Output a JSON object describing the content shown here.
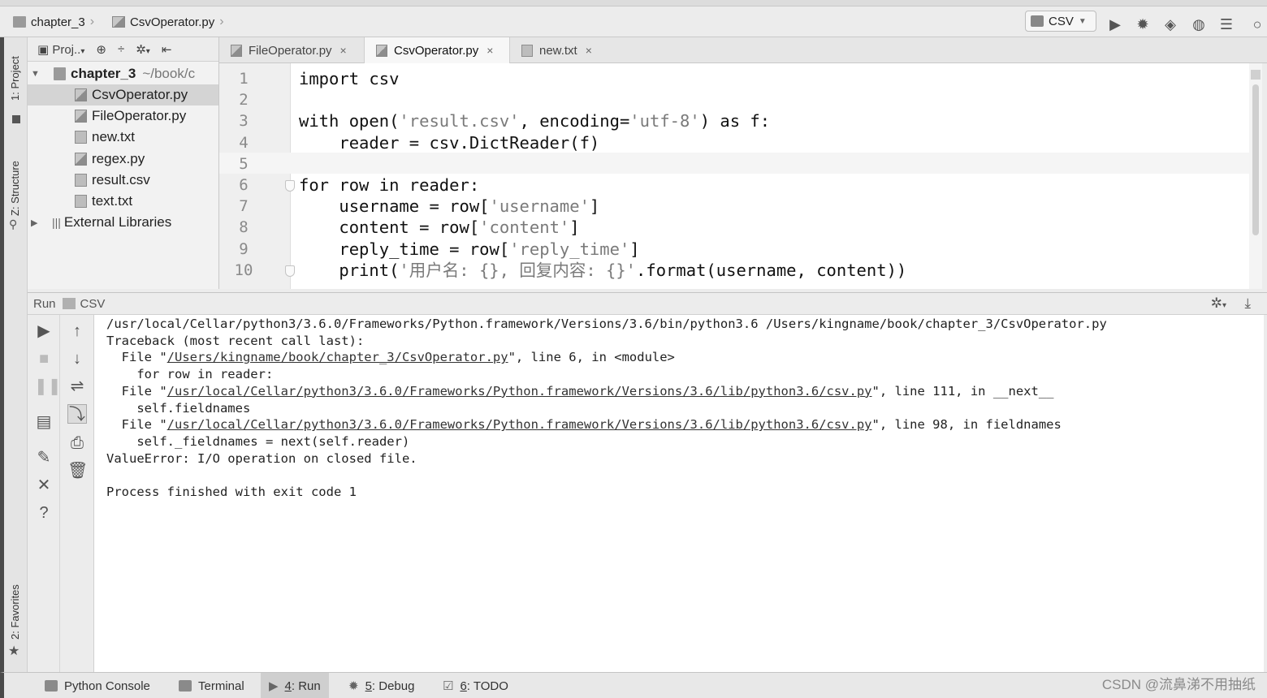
{
  "navbar": {
    "crumbs": [
      "chapter_3",
      "CsvOperator.py"
    ],
    "run_config": "CSV",
    "icons": [
      "run-icon",
      "debug-icon",
      "coverage-icon",
      "profile-icon",
      "build-icon",
      "search-icon"
    ]
  },
  "left_strip": {
    "project": "1: Project",
    "structure": "Z: Structure",
    "favorites": "2: Favorites"
  },
  "project_panel": {
    "toolbar_label": "Proj..",
    "root": {
      "name": "chapter_3",
      "path": "~/book/c"
    },
    "files": [
      "CsvOperator.py",
      "FileOperator.py",
      "new.txt",
      "regex.py",
      "result.csv",
      "text.txt"
    ],
    "selected": "CsvOperator.py",
    "libraries": "External Libraries"
  },
  "tabs": [
    {
      "label": "FileOperator.py",
      "close": "×"
    },
    {
      "label": "CsvOperator.py",
      "close": "×",
      "active": true
    },
    {
      "label": "new.txt",
      "close": "×"
    }
  ],
  "editor": {
    "line_numbers": [
      "1",
      "2",
      "3",
      "4",
      "5",
      "6",
      "7",
      "8",
      "9",
      "10"
    ],
    "lines": [
      [
        {
          "t": "import csv"
        }
      ],
      [
        {
          "t": ""
        }
      ],
      [
        {
          "t": "with open("
        },
        {
          "t": "'result.csv'",
          "s": true
        },
        {
          "t": ", encoding="
        },
        {
          "t": "'utf-8'",
          "s": true
        },
        {
          "t": ") as f:"
        }
      ],
      [
        {
          "t": "    reader = csv.DictReader(f)"
        }
      ],
      [
        {
          "t": ""
        }
      ],
      [
        {
          "t": "for row in reader:"
        }
      ],
      [
        {
          "t": "    username = row["
        },
        {
          "t": "'username'",
          "s": true
        },
        {
          "t": "]"
        }
      ],
      [
        {
          "t": "    content = row["
        },
        {
          "t": "'content'",
          "s": true
        },
        {
          "t": "]"
        }
      ],
      [
        {
          "t": "    reply_time = row["
        },
        {
          "t": "'reply_time'",
          "s": true
        },
        {
          "t": "]"
        }
      ],
      [
        {
          "t": "    print("
        },
        {
          "t": "'用户名: {}, 回复内容: {}'",
          "s": true
        },
        {
          "t": ".format(username, content))"
        }
      ]
    ]
  },
  "run_panel": {
    "label": "Run",
    "config": "CSV",
    "console": [
      [
        {
          "t": "/usr/local/Cellar/python3/3.6.0/Frameworks/Python.framework/Versions/3.6/bin/python3.6 /Users/kingname/book/chapter_3/CsvOperator.py"
        }
      ],
      [
        {
          "t": "Traceback (most recent call last):"
        }
      ],
      [
        {
          "t": "  File \""
        },
        {
          "t": "/Users/kingname/book/chapter_3/CsvOperator.py",
          "l": true
        },
        {
          "t": "\", line 6, in <module>"
        }
      ],
      [
        {
          "t": "    for row in reader:"
        }
      ],
      [
        {
          "t": "  File \""
        },
        {
          "t": "/usr/local/Cellar/python3/3.6.0/Frameworks/Python.framework/Versions/3.6/lib/python3.6/csv.py",
          "l": true
        },
        {
          "t": "\", line 111, in __next__"
        }
      ],
      [
        {
          "t": "    self.fieldnames"
        }
      ],
      [
        {
          "t": "  File \""
        },
        {
          "t": "/usr/local/Cellar/python3/3.6.0/Frameworks/Python.framework/Versions/3.6/lib/python3.6/csv.py",
          "l": true
        },
        {
          "t": "\", line 98, in fieldnames"
        }
      ],
      [
        {
          "t": "    self._fieldnames = next(self.reader)"
        }
      ],
      [
        {
          "t": "ValueError: I/O operation on closed file."
        }
      ],
      [
        {
          "t": ""
        }
      ],
      [
        {
          "t": "Process finished with exit code 1"
        }
      ]
    ]
  },
  "bottom_tabs": [
    {
      "pre": "",
      "key": "",
      "post": "Python Console"
    },
    {
      "pre": "",
      "key": "",
      "post": "Terminal"
    },
    {
      "pre": "",
      "key": "4",
      "post": ": Run",
      "active": true
    },
    {
      "pre": "",
      "key": "5",
      "post": ": Debug"
    },
    {
      "pre": "",
      "key": "6",
      "post": ": TODO"
    }
  ],
  "watermark": "CSDN @流鼻涕不用抽纸"
}
